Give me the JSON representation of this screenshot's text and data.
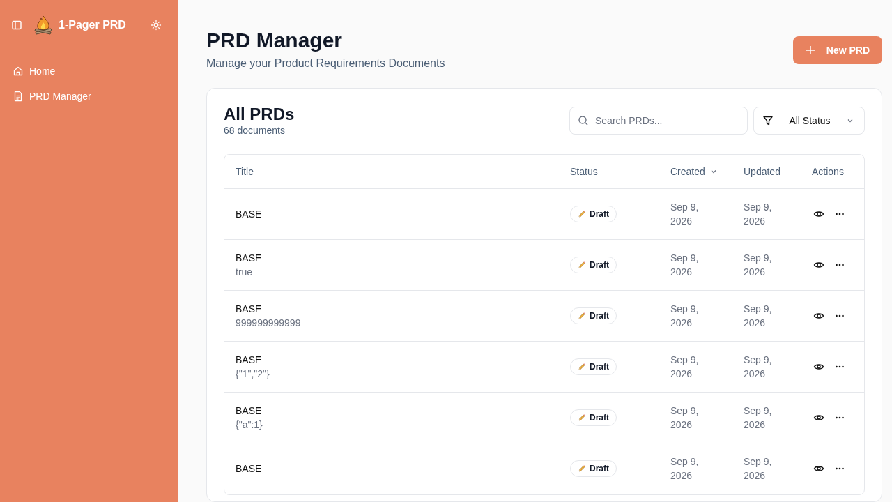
{
  "sidebar": {
    "app_name": "1-Pager PRD",
    "items": [
      {
        "label": "Home",
        "selected": false
      },
      {
        "label": "PRD Manager",
        "selected": false
      }
    ]
  },
  "header": {
    "title": "PRD Manager",
    "subtitle": "Manage your Product Requirements Documents",
    "new_button": "New PRD"
  },
  "card": {
    "title": "All PRDs",
    "count": "68 documents",
    "search": {
      "placeholder": "Search PRDs..."
    },
    "filter": {
      "value": "All Status"
    }
  },
  "table": {
    "columns": [
      {
        "label": "Title",
        "sorted": false
      },
      {
        "label": "Status",
        "sorted": false
      },
      {
        "label": "Created",
        "sorted": true
      },
      {
        "label": "Updated",
        "sorted": false
      },
      {
        "label": "Actions",
        "sorted": false
      }
    ],
    "rows": [
      {
        "title": "BASE",
        "subtitle": null,
        "status": "Draft",
        "created": "Sep 9, 2026",
        "updated": "Sep 9, 2026"
      },
      {
        "title": "BASE",
        "subtitle": "true",
        "status": "Draft",
        "created": "Sep 9, 2026",
        "updated": "Sep 9, 2026"
      },
      {
        "title": "BASE",
        "subtitle": "999999999999",
        "status": "Draft",
        "created": "Sep 9, 2026",
        "updated": "Sep 9, 2026"
      },
      {
        "title": "BASE",
        "subtitle": "{\"1\",\"2\"}",
        "status": "Draft",
        "created": "Sep 9, 2026",
        "updated": "Sep 9, 2026"
      },
      {
        "title": "BASE",
        "subtitle": "{\"a\":1}",
        "status": "Draft",
        "created": "Sep 9, 2026",
        "updated": "Sep 9, 2026"
      },
      {
        "title": "BASE",
        "subtitle": null,
        "status": "Draft",
        "created": "Sep 9, 2026",
        "updated": "Sep 9, 2026"
      }
    ]
  }
}
